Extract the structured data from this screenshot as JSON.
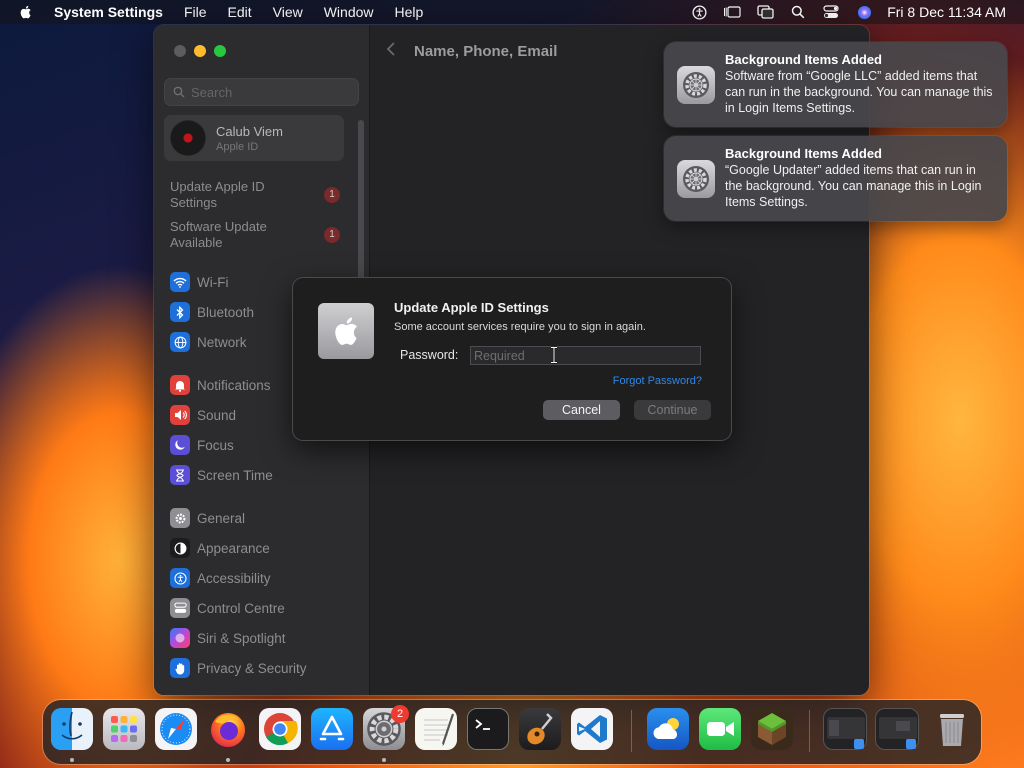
{
  "menubar": {
    "app_name": "System Settings",
    "items": [
      "File",
      "Edit",
      "View",
      "Window",
      "Help"
    ],
    "clock": "Fri 8 Dec  11:34 AM",
    "status_icons": [
      "accessibility-icon",
      "stage-manager-icon",
      "screen-mirroring-icon",
      "spotlight-icon",
      "control-centre-icon",
      "siri-icon"
    ]
  },
  "sidebar": {
    "search_placeholder": "Search",
    "account": {
      "name": "Calub Viem",
      "subtitle": "Apple ID"
    },
    "alerts": [
      {
        "label": "Update Apple ID Settings",
        "count": "1"
      },
      {
        "label": "Software Update Available",
        "count": "1"
      }
    ],
    "items": [
      {
        "label": "Wi-Fi",
        "icon": "wifi-icon",
        "color": "#1e6fd9"
      },
      {
        "label": "Bluetooth",
        "icon": "bluetooth-icon",
        "color": "#1e6fd9"
      },
      {
        "label": "Network",
        "icon": "globe-icon",
        "color": "#1e6fd9"
      },
      {
        "label": "Notifications",
        "icon": "bell-icon",
        "color": "#e0413a"
      },
      {
        "label": "Sound",
        "icon": "speaker-icon",
        "color": "#e0413a"
      },
      {
        "label": "Focus",
        "icon": "moon-icon",
        "color": "#5b4fd6"
      },
      {
        "label": "Screen Time",
        "icon": "hourglass-icon",
        "color": "#5b4fd6"
      },
      {
        "label": "General",
        "icon": "gear-icon",
        "color": "#8e8e93"
      },
      {
        "label": "Appearance",
        "icon": "appearance-icon",
        "color": "#1c1c1e"
      },
      {
        "label": "Accessibility",
        "icon": "accessibility-icon",
        "color": "#1e6fd9"
      },
      {
        "label": "Control Centre",
        "icon": "control-centre-icon",
        "color": "#8e8e93"
      },
      {
        "label": "Siri & Spotlight",
        "icon": "siri-icon",
        "color": "#b94ad6"
      },
      {
        "label": "Privacy & Security",
        "icon": "hand-icon",
        "color": "#1e6fd9"
      }
    ]
  },
  "content": {
    "title": "Name, Phone, Email"
  },
  "dialog": {
    "title": "Update Apple ID Settings",
    "message": "Some account services require you to sign in again.",
    "password_label": "Password:",
    "password_placeholder": "Required",
    "forgot_label": "Forgot Password?",
    "cancel_label": "Cancel",
    "continue_label": "Continue"
  },
  "notifications": [
    {
      "title": "Background Items Added",
      "body": "Software from “Google LLC” added items that can run in the background. You can manage this in Login Items Settings."
    },
    {
      "title": "Background Items Added",
      "body": "“Google Updater” added items that can run in the background. You can manage this in Login Items Settings."
    }
  ],
  "dock": {
    "apps": [
      "finder-icon",
      "launchpad-icon",
      "safari-icon",
      "firefox-icon",
      "chrome-icon",
      "app-store-icon",
      "system-settings-icon",
      "textedit-icon",
      "terminal-icon",
      "garageband-icon",
      "vscode-icon",
      "weather-icon",
      "facetime-icon",
      "minecraft-icon",
      "window-thumbnail-icon",
      "window-thumbnail-icon",
      "trash-icon"
    ],
    "settings_badge": "2"
  }
}
